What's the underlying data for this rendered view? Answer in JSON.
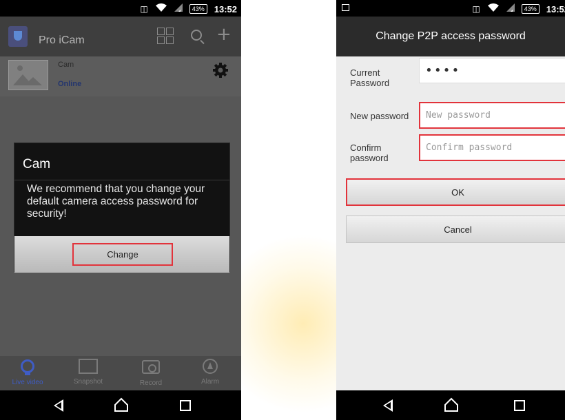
{
  "status_bar": {
    "battery": "43%",
    "time": "13:52"
  },
  "left_screen": {
    "app_title": "Pro iCam",
    "camera": {
      "name": "Cam",
      "status": "Online"
    },
    "dialog": {
      "title": "Cam",
      "message": "We recommend that you change your default camera access password for security!",
      "button": "Change"
    },
    "tabs": [
      {
        "label": "Live video",
        "icon": "live-video-icon",
        "active": true
      },
      {
        "label": "Snapshot",
        "icon": "snapshot-icon",
        "active": false
      },
      {
        "label": "Record",
        "icon": "record-icon",
        "active": false
      },
      {
        "label": "Alarm",
        "icon": "alarm-icon",
        "active": false
      }
    ]
  },
  "right_screen": {
    "title": "Change P2P access password",
    "current_password": {
      "label": "Current Password",
      "value": "••••"
    },
    "new_password": {
      "label": "New password",
      "placeholder": "New password"
    },
    "confirm_password": {
      "label": "Confirm password",
      "placeholder": "Confirm password"
    },
    "ok_button": "OK",
    "cancel_button": "Cancel"
  },
  "colors": {
    "highlight": "#e2333b",
    "accent_blue": "#3f5cc4",
    "status_online": "#23356e"
  },
  "icons": [
    "vibrate-icon",
    "wifi-icon",
    "signal-icon",
    "battery-icon",
    "grid-icon",
    "search-icon",
    "plus-icon",
    "gear-icon",
    "back-icon",
    "home-icon",
    "recents-icon"
  ]
}
